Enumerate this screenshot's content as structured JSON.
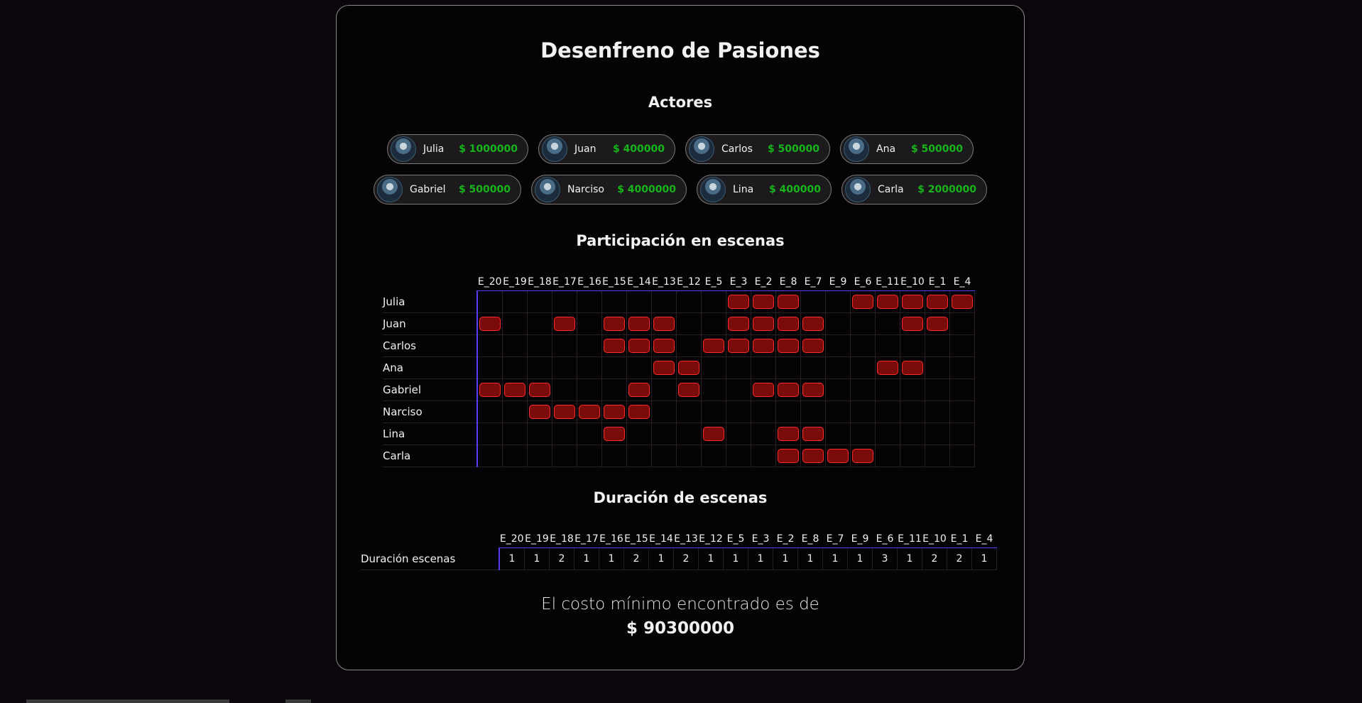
{
  "title": "Desenfreno de Pasiones",
  "actors_heading": "Actores",
  "actors": [
    {
      "name": "Julia",
      "cost": "$ 1000000"
    },
    {
      "name": "Juan",
      "cost": "$ 400000"
    },
    {
      "name": "Carlos",
      "cost": "$ 500000"
    },
    {
      "name": "Ana",
      "cost": "$ 500000"
    },
    {
      "name": "Gabriel",
      "cost": "$ 500000"
    },
    {
      "name": "Narciso",
      "cost": "$ 4000000"
    },
    {
      "name": "Lina",
      "cost": "$ 400000"
    },
    {
      "name": "Carla",
      "cost": "$ 2000000"
    }
  ],
  "participation_heading": "Participación en escenas",
  "scenes": [
    "E_20",
    "E_19",
    "E_18",
    "E_17",
    "E_16",
    "E_15",
    "E_14",
    "E_13",
    "E_12",
    "E_5",
    "E_3",
    "E_2",
    "E_8",
    "E_7",
    "E_9",
    "E_6",
    "E_11",
    "E_10",
    "E_1",
    "E_4"
  ],
  "participation": [
    {
      "actor": "Julia",
      "cells": [
        0,
        0,
        0,
        0,
        0,
        0,
        0,
        0,
        0,
        0,
        1,
        1,
        1,
        0,
        0,
        1,
        1,
        1,
        1,
        1
      ]
    },
    {
      "actor": "Juan",
      "cells": [
        1,
        0,
        0,
        1,
        0,
        1,
        1,
        1,
        0,
        0,
        1,
        1,
        1,
        1,
        0,
        0,
        0,
        1,
        1,
        0
      ]
    },
    {
      "actor": "Carlos",
      "cells": [
        0,
        0,
        0,
        0,
        0,
        1,
        1,
        1,
        0,
        1,
        1,
        1,
        1,
        1,
        0,
        0,
        0,
        0,
        0,
        0
      ]
    },
    {
      "actor": "Ana",
      "cells": [
        0,
        0,
        0,
        0,
        0,
        0,
        0,
        1,
        1,
        0,
        0,
        0,
        0,
        0,
        0,
        0,
        1,
        1,
        0,
        0
      ]
    },
    {
      "actor": "Gabriel",
      "cells": [
        1,
        1,
        1,
        0,
        0,
        0,
        1,
        0,
        1,
        0,
        0,
        1,
        1,
        1,
        0,
        0,
        0,
        0,
        0,
        0
      ]
    },
    {
      "actor": "Narciso",
      "cells": [
        0,
        0,
        1,
        1,
        1,
        1,
        1,
        0,
        0,
        0,
        0,
        0,
        0,
        0,
        0,
        0,
        0,
        0,
        0,
        0
      ]
    },
    {
      "actor": "Lina",
      "cells": [
        0,
        0,
        0,
        0,
        0,
        1,
        0,
        0,
        0,
        1,
        0,
        0,
        1,
        1,
        0,
        0,
        0,
        0,
        0,
        0
      ]
    },
    {
      "actor": "Carla",
      "cells": [
        0,
        0,
        0,
        0,
        0,
        0,
        0,
        0,
        0,
        0,
        0,
        0,
        1,
        1,
        1,
        1,
        0,
        0,
        0,
        0
      ]
    }
  ],
  "duration_heading": "Duración de escenas",
  "duration_row_label": "Duración escenas",
  "durations": [
    "1",
    "1",
    "2",
    "1",
    "1",
    "2",
    "1",
    "2",
    "1",
    "1",
    "1",
    "1",
    "1",
    "1",
    "1",
    "3",
    "1",
    "2",
    "2",
    "1"
  ],
  "cost_label": "El costo mínimo encontrado es de",
  "cost_value": "$ 90300000",
  "colors": {
    "accent": "#5a3df0",
    "cost_green": "#16b51a",
    "participation_fill": "#7a0b0b",
    "participation_border": "#ff2a2a"
  }
}
